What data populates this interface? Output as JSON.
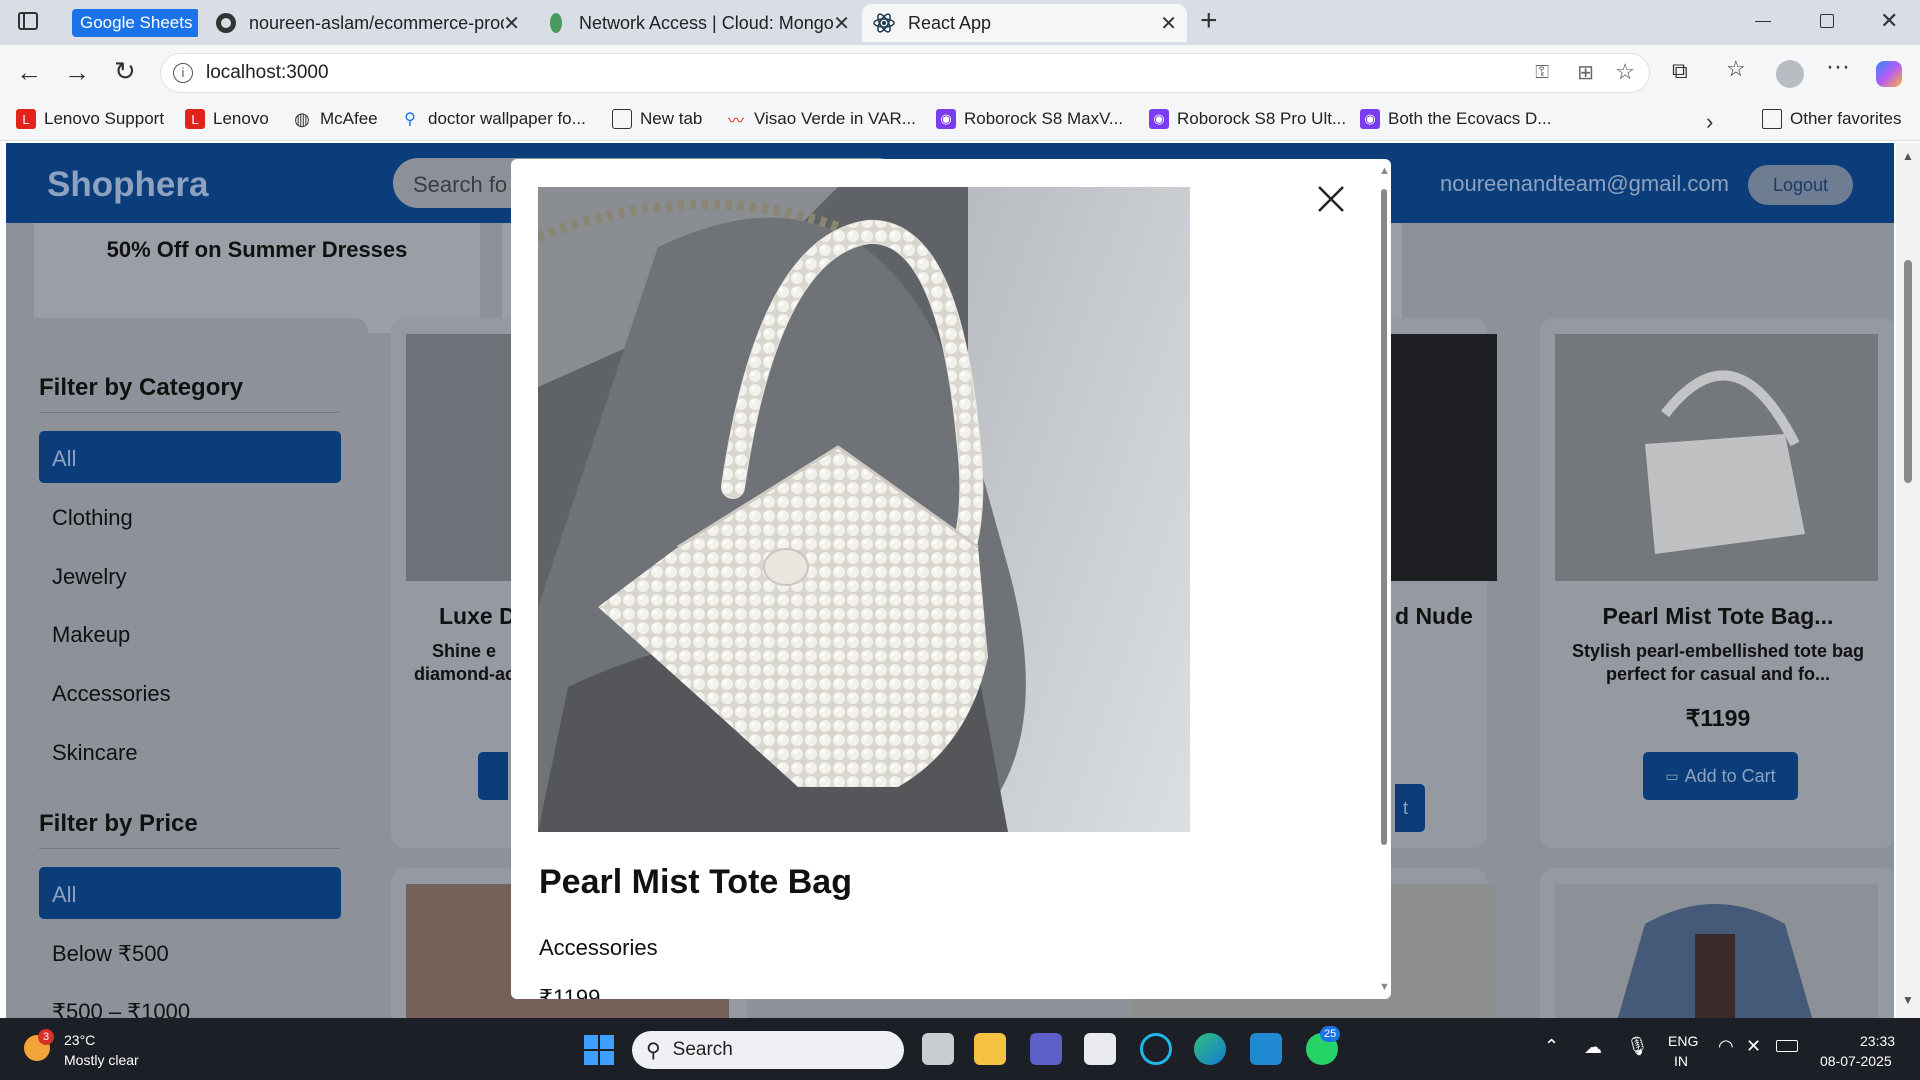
{
  "browser": {
    "tabs": [
      {
        "label": "Google Sheets"
      },
      {
        "label": "noureen-aslam/ecommerce-prod"
      },
      {
        "label": "Network Access | Cloud: MongoD"
      },
      {
        "label": "React App"
      }
    ],
    "new_tab_glyph": "+",
    "address": "localhost:3000",
    "bookmarks": [
      {
        "label": "Lenovo Support"
      },
      {
        "label": "Lenovo"
      },
      {
        "label": "McAfee"
      },
      {
        "label": "doctor wallpaper fo..."
      },
      {
        "label": "New tab"
      },
      {
        "label": "Visao Verde in VAR..."
      },
      {
        "label": "Roborock S8 MaxV..."
      },
      {
        "label": "Roborock S8 Pro Ult..."
      },
      {
        "label": "Both the Ecovacs D..."
      },
      {
        "label": "Other favorites"
      }
    ]
  },
  "app": {
    "brand": "Shophera",
    "search_placeholder": "Search fo",
    "user_email": "noureenandteam@gmail.com",
    "logout_label": "Logout",
    "promo_text": "50% Off on Summer Dresses",
    "filters": {
      "category_heading": "Filter by Category",
      "categories": [
        "All",
        "Clothing",
        "Jewelry",
        "Makeup",
        "Accessories",
        "Skincare"
      ],
      "price_heading": "Filter by Price",
      "prices": [
        "All",
        "Below ₹500",
        "₹500 – ₹1000"
      ]
    },
    "products": [
      {
        "name_fragment": "Luxe Dia",
        "desc_line1": "Shine e",
        "desc_line2": "diamond-ac"
      },
      {
        "name_fragment": "d Nude",
        "button_fragment": "t"
      },
      {
        "name": "Pearl Mist Tote Bag...",
        "desc": "Stylish pearl-embellished tote bag perfect for casual and fo...",
        "price": "₹1199",
        "add_label": "Add to Cart"
      }
    ]
  },
  "modal": {
    "title": "Pearl Mist Tote Bag",
    "category": "Accessories",
    "price": "₹1199"
  },
  "taskbar": {
    "weather_temp": "23°C",
    "weather_desc": "Mostly clear",
    "weather_badge": "3",
    "search_label": "Search",
    "whatsapp_badge": "25",
    "lang_line1": "ENG",
    "lang_line2": "IN",
    "time": "23:33",
    "date": "08-07-2025"
  },
  "colors": {
    "brand_blue": "#0b54c4",
    "overlay": "rgba(0,0,0,0.45)"
  }
}
